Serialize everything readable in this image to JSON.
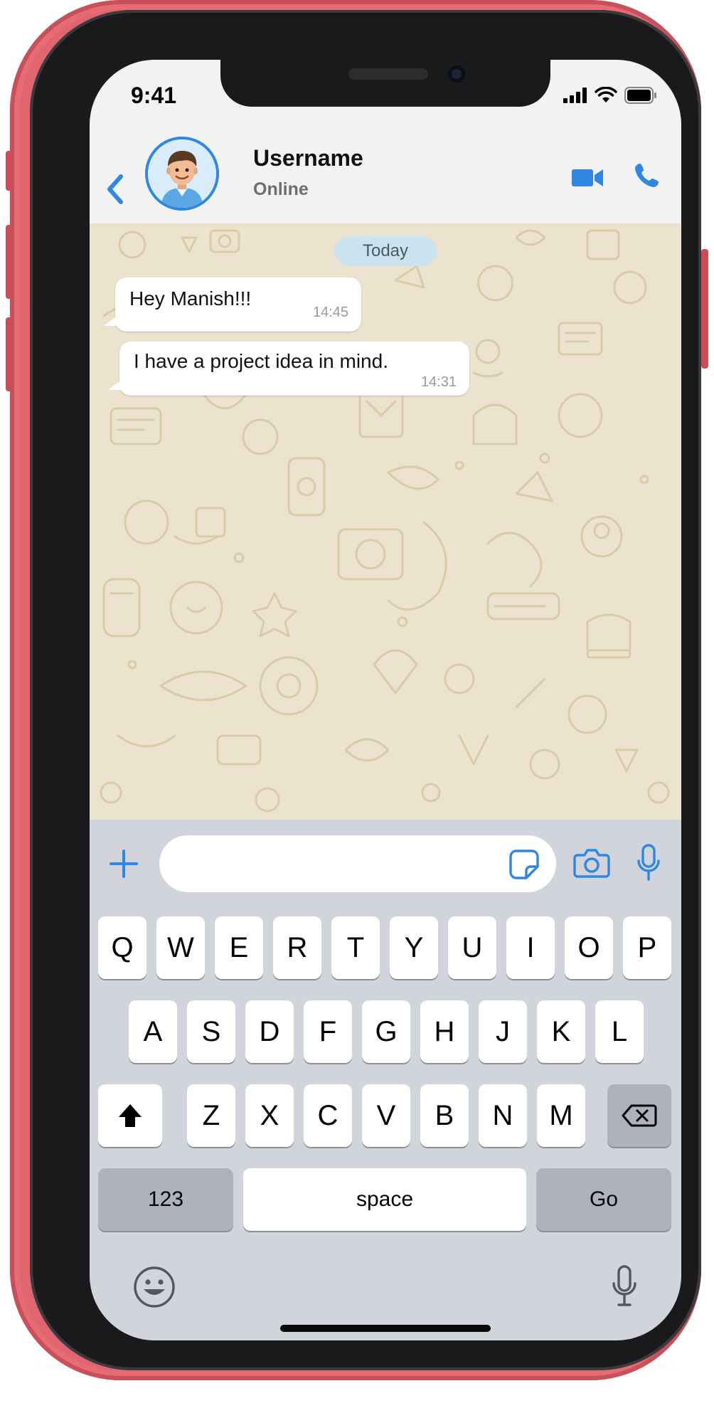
{
  "status_bar": {
    "time": "9:41"
  },
  "header": {
    "contact_name": "Username",
    "contact_status": "Online"
  },
  "chat": {
    "date_label": "Today",
    "messages": [
      {
        "text": "Hey Manish!!!",
        "time": "14:45"
      },
      {
        "text": "I have a project idea in mind.",
        "time": "14:31"
      }
    ]
  },
  "composer": {
    "value": "",
    "placeholder": ""
  },
  "keyboard": {
    "row1": [
      "Q",
      "W",
      "E",
      "R",
      "T",
      "Y",
      "U",
      "I",
      "O",
      "P"
    ],
    "row2": [
      "A",
      "S",
      "D",
      "F",
      "G",
      "H",
      "J",
      "K",
      "L"
    ],
    "row3": [
      "Z",
      "X",
      "C",
      "V",
      "B",
      "N",
      "M"
    ],
    "numbers_label": "123",
    "space_label": "space",
    "go_label": "Go"
  },
  "colors": {
    "accent": "#2f87e3",
    "chat_background": "#ece3cf",
    "phone_body": "#e1656f",
    "date_pill": "#cbe3ee"
  },
  "icons": [
    "back-chevron-icon",
    "video-call-icon",
    "phone-call-icon",
    "plus-icon",
    "sticker-icon",
    "camera-icon",
    "microphone-icon",
    "shift-icon",
    "backspace-icon",
    "emoji-icon",
    "dictation-icon",
    "signal-icon",
    "wifi-icon",
    "battery-icon"
  ]
}
